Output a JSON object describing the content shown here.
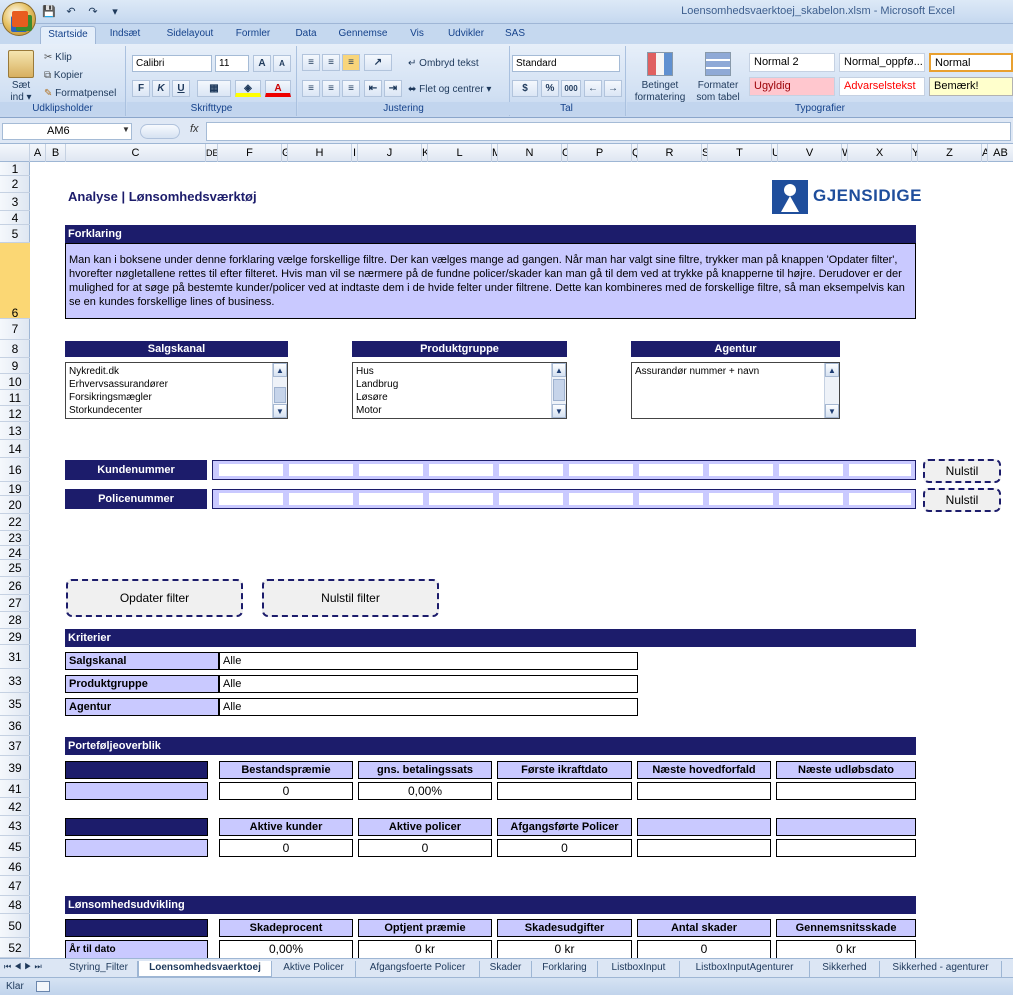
{
  "window": {
    "title": "Loensomhedsvaerktoej_skabelon.xlsm - Microsoft Excel"
  },
  "qat": {
    "save": "💾",
    "undo": "↶",
    "redo": "↷",
    "customize": "▾"
  },
  "ribbon_tabs": [
    "Startside",
    "Indsæt",
    "Sidelayout",
    "Formler",
    "Data",
    "Gennemse",
    "Vis",
    "Udvikler",
    "SAS"
  ],
  "ribbon": {
    "clipboard": {
      "paste": "Sæt ind",
      "paste_arrow": "▾",
      "cut": "Klip",
      "copy": "Kopier",
      "format_painter": "Formatpensel",
      "label": "Udklipsholder"
    },
    "font": {
      "name": "Calibri",
      "size": "11",
      "grow": "A",
      "shrink": "A",
      "bold": "F",
      "italic": "K",
      "underline": "U",
      "label": "Skrifttype"
    },
    "alignment": {
      "wrap": "Ombryd tekst",
      "merge": "Flet og centrer",
      "label": "Justering"
    },
    "number": {
      "format": "Standard",
      "percent": "%",
      "thousands": "000",
      "label": "Tal"
    },
    "styles": {
      "conditional": "Betinget formatering",
      "format_table": "Formater som tabel",
      "cells": [
        "Normal 2",
        "Normal_oppfø...",
        "Normal",
        "Ugyldig",
        "Advarselstekst",
        "Bemærk!"
      ],
      "label": "Typografier"
    }
  },
  "formula_bar": {
    "name_box": "AM6",
    "fx": "fx",
    "value": ""
  },
  "columns": [
    "A",
    "B",
    "C",
    "D",
    "E",
    "F",
    "G",
    "H",
    "I",
    "J",
    "K",
    "L",
    "M",
    "N",
    "O",
    "P",
    "Q",
    "R",
    "S",
    "T",
    "U",
    "V",
    "W",
    "X",
    "Y",
    "Z",
    "AA",
    "AB"
  ],
  "column_labels": [
    "A",
    "B",
    "C",
    "DE",
    "F",
    "G",
    "H",
    "I",
    "J",
    "K",
    "L",
    "M",
    "N",
    "O",
    "P",
    "Q",
    "R",
    "S",
    "T",
    "U",
    "V",
    "W",
    "X",
    "Y",
    "Z",
    "A",
    "AB"
  ],
  "rows": [
    "1",
    "2",
    "3",
    "4",
    "5",
    "6",
    "7",
    "8",
    "9",
    "10",
    "11",
    "12",
    "13",
    "14",
    "16",
    "19",
    "20",
    "22",
    "23",
    "24",
    "25",
    "26",
    "27",
    "28",
    "29",
    "31",
    "33",
    "35",
    "36",
    "37",
    "39",
    "41",
    "42",
    "43",
    "45",
    "46",
    "47",
    "48",
    "50",
    "52"
  ],
  "sheet": {
    "title": "Analyse | Lønsomhedsværktøj",
    "logo_text": "GJENSIDIGE",
    "explanation": {
      "header": "Forklaring",
      "text": "Man kan i boksene under denne forklaring vælge forskellige filtre. Der kan vælges mange ad gangen. Når man har valgt sine filtre, trykker man på knappen 'Opdater filter', hvorefter nøgletallene rettes til efter filteret. Hvis man vil se nærmere på de fundne policer/skader kan man gå til dem ved at trykke på knapperne til højre. Derudover er der mulighed for at søge på bestemte kunder/policer ved at indtaste dem i de hvide felter under filtrene. Dette kan kombineres med de forskellige filtre, så man eksempelvis kan se en kundes forskellige lines of business."
    },
    "filters": {
      "salgskanal": {
        "header": "Salgskanal",
        "items": [
          "Nykredit.dk",
          "Erhvervsassurandører",
          "Forsikringsmægler",
          "Storkundecenter"
        ]
      },
      "produktgruppe": {
        "header": "Produktgruppe",
        "items": [
          "Hus",
          "Landbrug",
          "Løsøre",
          "Motor"
        ]
      },
      "agentur": {
        "header": "Agentur",
        "items": [
          "Assurandør nummer + navn"
        ]
      }
    },
    "search": {
      "kundenummer": {
        "label": "Kundenummer",
        "reset": "Nulstil"
      },
      "policenummer": {
        "label": "Policenummer",
        "reset": "Nulstil"
      }
    },
    "buttons": {
      "update": "Opdater filter",
      "reset_all": "Nulstil filter"
    },
    "criteria": {
      "header": "Kriterier",
      "rows": [
        {
          "label": "Salgskanal",
          "value": "Alle"
        },
        {
          "label": "Produktgruppe",
          "value": "Alle"
        },
        {
          "label": "Agentur",
          "value": "Alle"
        }
      ]
    },
    "portfolio": {
      "header": "Porteføljeoverblik",
      "row1_heads": [
        "Bestandspræmie",
        "gns. betalingssats",
        "Første ikraftdato",
        "Næste hovedforfald",
        "Næste udløbsdato"
      ],
      "row1_vals": [
        "0",
        "0,00%",
        "",
        "",
        ""
      ],
      "row2_heads": [
        "Aktive kunder",
        "Aktive policer",
        "Afgangsførte Policer",
        "",
        ""
      ],
      "row2_vals": [
        "0",
        "0",
        "0",
        "",
        ""
      ]
    },
    "profitability": {
      "header": "Lønsomhedsudvikling",
      "heads": [
        "Skadeprocent",
        "Optjent præmie",
        "Skadesudgifter",
        "Antal skader",
        "Gennemsnitsskade"
      ],
      "row_label": "År til dato",
      "vals": [
        "0,00%",
        "0 kr",
        "0 kr",
        "0",
        "0 kr"
      ]
    }
  },
  "sheet_tabs": [
    "Styring_Filter",
    "Loensomhedsvaerktoej",
    "Aktive Policer",
    "Afgangsfoerte Policer",
    "Skader",
    "Forklaring",
    "ListboxInput",
    "ListboxInputAgenturer",
    "Sikkerhed",
    "Sikkerhed - agenturer"
  ],
  "status": {
    "text": "Klar"
  }
}
